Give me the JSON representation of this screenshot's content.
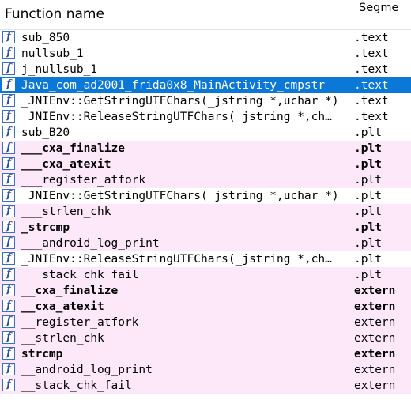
{
  "header": {
    "function_name": "Function name",
    "segment": "Segme"
  },
  "icon_glyph": "f",
  "rows": [
    {
      "name": "sub_850",
      "segment": ".text",
      "bold": false,
      "pink": false
    },
    {
      "name": "nullsub_1",
      "segment": ".text",
      "bold": false,
      "pink": false
    },
    {
      "name": "j_nullsub_1",
      "segment": ".text",
      "bold": false,
      "pink": false
    },
    {
      "name": "Java_com_ad2001_frida0x8_MainActivity_cmpstr",
      "segment": ".text",
      "bold": false,
      "pink": false,
      "selected": true
    },
    {
      "name": "_JNIEnv::GetStringUTFChars(_jstring *,uchar *)",
      "segment": ".text",
      "bold": false,
      "pink": false
    },
    {
      "name": "_JNIEnv::ReleaseStringUTFChars(_jstring *,ch…",
      "segment": ".text",
      "bold": false,
      "pink": false
    },
    {
      "name": "sub_B20",
      "segment": ".plt",
      "bold": false,
      "pink": false
    },
    {
      "name": "___cxa_finalize",
      "segment": ".plt",
      "bold": true,
      "pink": true
    },
    {
      "name": "___cxa_atexit",
      "segment": ".plt",
      "bold": true,
      "pink": true
    },
    {
      "name": "___register_atfork",
      "segment": ".plt",
      "bold": false,
      "pink": true
    },
    {
      "name": "_JNIEnv::GetStringUTFChars(_jstring *,uchar *)",
      "segment": ".plt",
      "bold": false,
      "pink": false
    },
    {
      "name": "___strlen_chk",
      "segment": ".plt",
      "bold": false,
      "pink": true
    },
    {
      "name": "_strcmp",
      "segment": ".plt",
      "bold": true,
      "pink": true
    },
    {
      "name": "___android_log_print",
      "segment": ".plt",
      "bold": false,
      "pink": true
    },
    {
      "name": "_JNIEnv::ReleaseStringUTFChars(_jstring *,ch…",
      "segment": ".plt",
      "bold": false,
      "pink": false
    },
    {
      "name": "___stack_chk_fail",
      "segment": ".plt",
      "bold": false,
      "pink": true
    },
    {
      "name": "__cxa_finalize",
      "segment": "extern",
      "bold": true,
      "pink": true
    },
    {
      "name": "__cxa_atexit",
      "segment": "extern",
      "bold": true,
      "pink": true
    },
    {
      "name": "__register_atfork",
      "segment": "extern",
      "bold": false,
      "pink": true
    },
    {
      "name": "__strlen_chk",
      "segment": "extern",
      "bold": false,
      "pink": true
    },
    {
      "name": "strcmp",
      "segment": "extern",
      "bold": true,
      "pink": true
    },
    {
      "name": "__android_log_print",
      "segment": "extern",
      "bold": false,
      "pink": true
    },
    {
      "name": "__stack_chk_fail",
      "segment": "extern",
      "bold": false,
      "pink": true
    }
  ],
  "colors": {
    "selection": "#0b78d7",
    "library_row": "#fde8fa",
    "icon_border": "#3c6fc6"
  }
}
